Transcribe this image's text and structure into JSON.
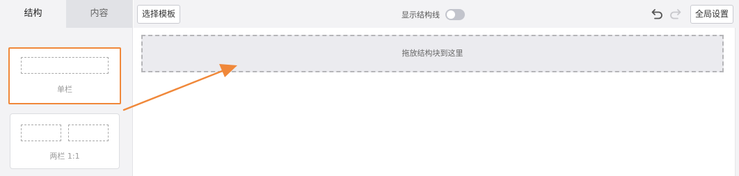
{
  "tabs": [
    {
      "label": "结构",
      "active": true
    },
    {
      "label": "内容",
      "active": false
    }
  ],
  "blocks": {
    "single_label": "单栏",
    "double_label": "两栏 1:1"
  },
  "toolbar": {
    "template_label": "选择模板",
    "structure_lines_label": "显示结构线",
    "structure_lines_on": false,
    "global_settings_label": "全局设置",
    "undo_icon": "undo-icon",
    "redo_icon": "redo-icon"
  },
  "canvas": {
    "dropzone_text": "拖放结构块到这里"
  },
  "colors": {
    "highlight": "#f0883a",
    "arrow": "#f0883a",
    "panel_bg": "#f3f3f5"
  }
}
